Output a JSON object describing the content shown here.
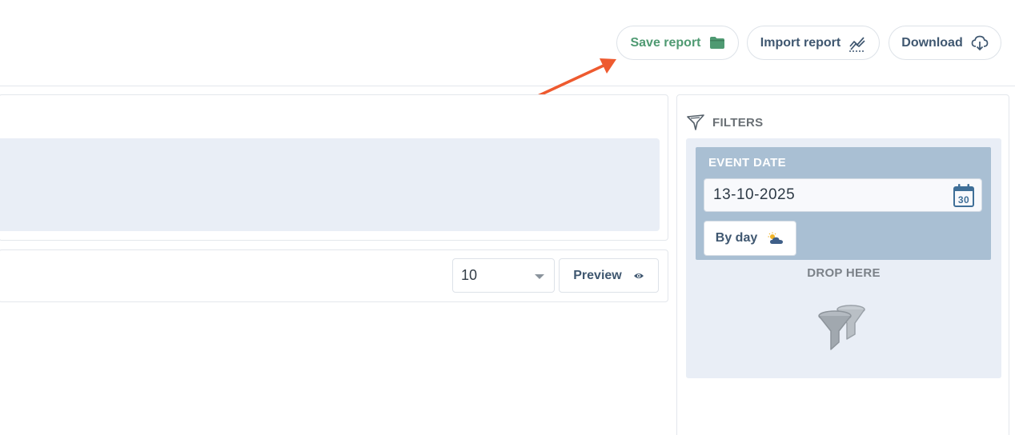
{
  "toolbar": {
    "save_label": "Save report",
    "import_label": "Import report",
    "download_label": "Download"
  },
  "results": {
    "limit_value": "10",
    "preview_label": "Preview"
  },
  "filters": {
    "title": "FILTERS",
    "event_date_label": "EVENT DATE",
    "event_date_value": "13-10-2025",
    "granularity_label": "By day",
    "drop_label": "DROP HERE"
  },
  "colors": {
    "accent_green": "#4f9a72",
    "text_slate": "#3f5770",
    "annotation_arrow": "#ee5a2f",
    "event_card": "#a9bfd3",
    "drop_zone": "#e9eef6"
  },
  "icons": {
    "save": "folder-icon",
    "import": "chart-line-icon",
    "download": "cloud-download-icon",
    "preview": "eye-icon",
    "filters": "funnel-icon",
    "date": "calendar-icon",
    "granularity": "weather-icon",
    "drop": "funnels-icon"
  }
}
